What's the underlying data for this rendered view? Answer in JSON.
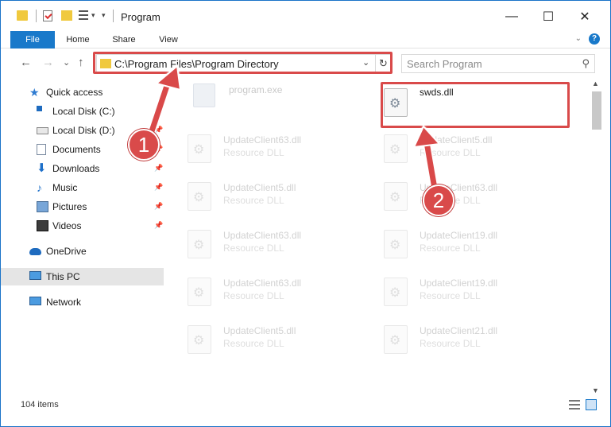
{
  "window": {
    "title": "Program",
    "controls": {
      "minimize": "—",
      "maximize": "☐",
      "close": "✕"
    }
  },
  "ribbon": {
    "tabs": [
      "File",
      "Home",
      "Share",
      "View"
    ],
    "help": "?"
  },
  "nav": {
    "back": "←",
    "forward": "→",
    "recent": "⌄",
    "up": "↑",
    "address": "C:\\Program Files\\Program Directory",
    "address_dropdown": "⌄",
    "refresh": "↻",
    "search_placeholder": "Search Program",
    "search_icon": "⚲"
  },
  "sidebar": {
    "items": [
      {
        "label": "Quick access",
        "icon": "star-icon",
        "pinned": false
      },
      {
        "label": "Local Disk (C:)",
        "icon": "drive-icon",
        "pinned": false
      },
      {
        "label": "Local Disk (D:)",
        "icon": "drive-icon",
        "pinned": true
      },
      {
        "label": "Documents",
        "icon": "documents-icon",
        "pinned": true
      },
      {
        "label": "Downloads",
        "icon": "download-icon",
        "pinned": true
      },
      {
        "label": "Music",
        "icon": "music-icon",
        "pinned": true
      },
      {
        "label": "Pictures",
        "icon": "pictures-icon",
        "pinned": true
      },
      {
        "label": "Videos",
        "icon": "videos-icon",
        "pinned": true
      },
      {
        "label": "OneDrive",
        "icon": "cloud-icon",
        "pinned": false
      },
      {
        "label": "This PC",
        "icon": "computer-icon",
        "pinned": false,
        "selected": true
      },
      {
        "label": "Network",
        "icon": "network-icon",
        "pinned": false
      }
    ],
    "pin_glyph": "📌"
  },
  "files": {
    "left_column": [
      {
        "name": "program.exe",
        "type": ""
      },
      {
        "name": "UpdateClient63.dll",
        "type": "Resource DLL"
      },
      {
        "name": "UpdateClient5.dll",
        "type": "Resource DLL"
      },
      {
        "name": "UpdateClient63.dll",
        "type": "Resource DLL"
      },
      {
        "name": "UpdateClient63.dll",
        "type": "Resource DLL"
      },
      {
        "name": "UpdateClient5.dll",
        "type": "Resource DLL"
      }
    ],
    "right_column": [
      {
        "name": "swds.dll",
        "type": "",
        "highlighted": true
      },
      {
        "name": "UpdateClient5.dll",
        "type": "Resource DLL"
      },
      {
        "name": "UpdateClient63.dll",
        "type": "Resource DLL"
      },
      {
        "name": "UpdateClient19.dll",
        "type": "Resource DLL"
      },
      {
        "name": "UpdateClient19.dll",
        "type": "Resource DLL"
      },
      {
        "name": "UpdateClient21.dll",
        "type": "Resource DLL"
      }
    ]
  },
  "status": {
    "count": "104 items"
  },
  "annotations": {
    "badge1": "1",
    "badge2": "2",
    "color": "#d94a4a"
  }
}
